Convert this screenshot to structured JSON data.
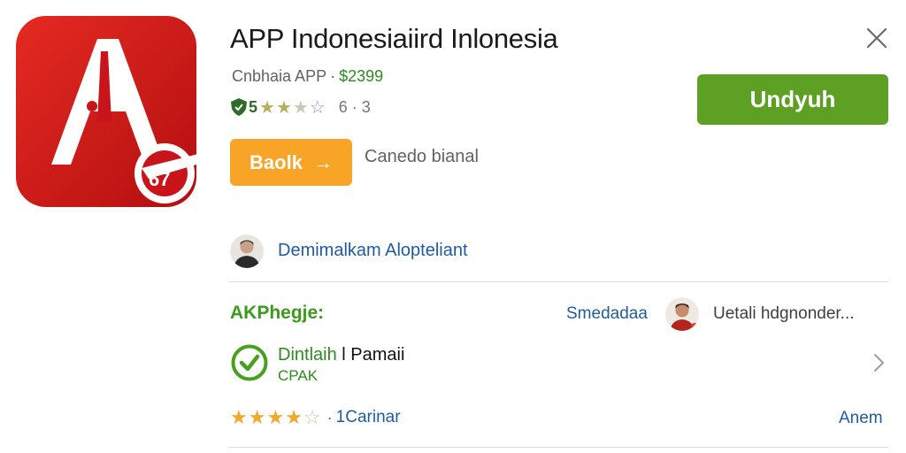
{
  "app": {
    "title": "APP Indonesiaiird Inlonesia",
    "category": "Cnbhaia APP",
    "separator": "·",
    "price": "$2399",
    "rating": "5",
    "reviews": "6 · 3",
    "install_label": "Undyuh",
    "icon_name": "app-logo-icon"
  },
  "actions": {
    "secondary_label": "Baolk",
    "secondary_arrow": "→",
    "side_text": "Canedo bianal"
  },
  "developer": {
    "name": "Demimalkam Alopteliant"
  },
  "section": {
    "label": "AKPhegje:",
    "link": "Smedadaa",
    "user_text": "Uetali hdgnonder..."
  },
  "item": {
    "title_green": "Dintlaih",
    "title_dark": "l Pamaii",
    "subtitle": "CPAK"
  },
  "bottom": {
    "separator": "·",
    "count": "1Carinar",
    "link": "Anem"
  },
  "colors": {
    "install": "#5da023",
    "secondary_button": "#f7a427",
    "link": "#1f5c9e",
    "accent_green": "#2e8b1f",
    "icon_red": "#d01818"
  }
}
